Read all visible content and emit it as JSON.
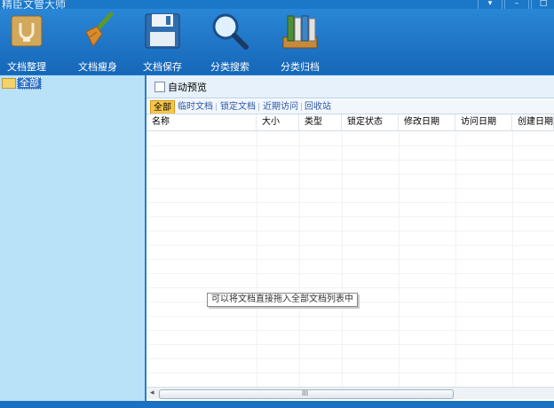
{
  "app": {
    "title": "精臣文管大师"
  },
  "window_controls": [
    "▾",
    "–",
    "□"
  ],
  "toolbar": {
    "items": [
      {
        "label": "文档整理",
        "icon": "box-icon"
      },
      {
        "label": "文档瘦身",
        "icon": "broom-icon"
      },
      {
        "label": "文档保存",
        "icon": "floppy-disk-icon"
      },
      {
        "label": "分类搜索",
        "icon": "magnifier-icon"
      },
      {
        "label": "分类归档",
        "icon": "binders-icon"
      }
    ]
  },
  "tree": {
    "root_label": "全部"
  },
  "auto_preview": {
    "label": "自动预览",
    "checked": false
  },
  "tabs": [
    "全部",
    "临时文档",
    "锁定文档",
    "近期访问",
    "回收站"
  ],
  "active_tab": "全部",
  "table": {
    "columns": [
      "名称",
      "大小",
      "类型",
      "锁定状态",
      "修改日期",
      "访问日期",
      "创建日期"
    ],
    "rows": []
  },
  "hint": "可以将文档直接拖入全部文档列表中",
  "scrollbar": {
    "grip": "III"
  },
  "colors": {
    "toolbar_bg": "#1b78c8",
    "sidebar_bg": "#b9e1f7",
    "active_tab": "#f7c64a",
    "tree_selected": "#3474c6"
  }
}
